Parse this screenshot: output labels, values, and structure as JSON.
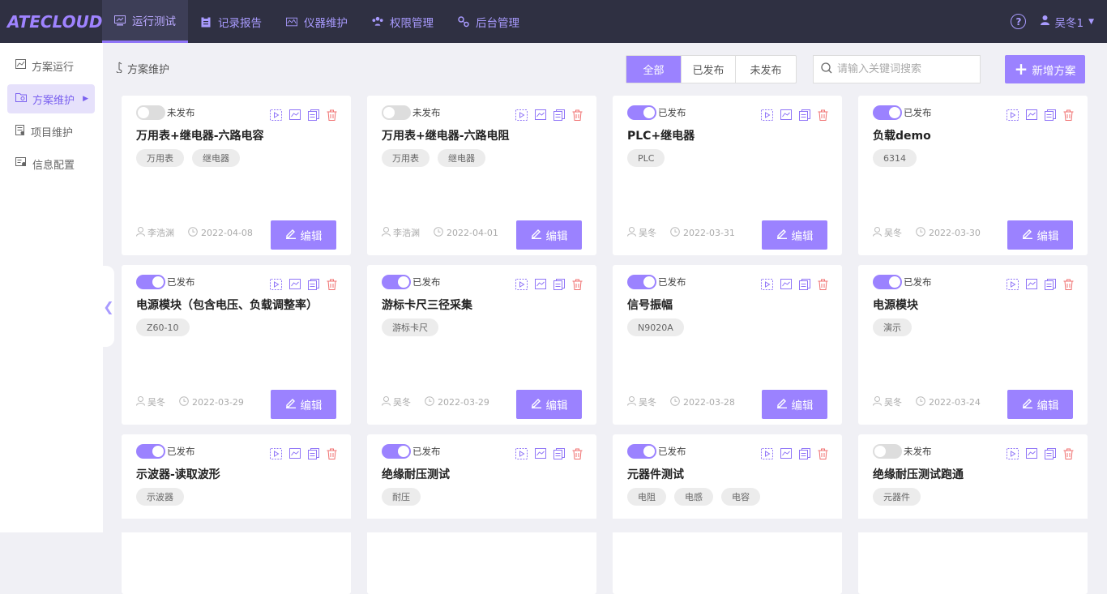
{
  "app": {
    "logo": "ATECLOUD"
  },
  "topnav": [
    {
      "label": "运行测试",
      "icon": "monitor-icon",
      "active": true
    },
    {
      "label": "记录报告",
      "icon": "clipboard-icon",
      "active": false
    },
    {
      "label": "仪器维护",
      "icon": "instrument-icon",
      "active": false
    },
    {
      "label": "权限管理",
      "icon": "users-icon",
      "active": false
    },
    {
      "label": "后台管理",
      "icon": "settings-nodes-icon",
      "active": false
    }
  ],
  "user": {
    "name": "吴冬1",
    "help": "?"
  },
  "sidebar": [
    {
      "label": "方案运行",
      "icon": "chart-icon",
      "active": false
    },
    {
      "label": "方案维护",
      "icon": "folder-icon",
      "active": true
    },
    {
      "label": "项目维护",
      "icon": "document-icon",
      "active": false
    },
    {
      "label": "信息配置",
      "icon": "config-icon",
      "active": false
    }
  ],
  "breadcrumb": "方案维护",
  "filters": [
    "全部",
    "已发布",
    "未发布"
  ],
  "search": {
    "placeholder": "请输入关键词搜索"
  },
  "add_button": "新增方案",
  "edit_label": "编辑",
  "cards": [
    {
      "published": false,
      "status": "未发布",
      "title": "万用表+继电器-六路电容",
      "tags": [
        "万用表",
        "继电器"
      ],
      "author": "李浩渊",
      "date": "2022-04-08"
    },
    {
      "published": false,
      "status": "未发布",
      "title": "万用表+继电器-六路电阻",
      "tags": [
        "万用表",
        "继电器"
      ],
      "author": "李浩渊",
      "date": "2022-04-01"
    },
    {
      "published": true,
      "status": "已发布",
      "title": "PLC+继电器",
      "tags": [
        "PLC"
      ],
      "author": "吴冬",
      "date": "2022-03-31"
    },
    {
      "published": true,
      "status": "已发布",
      "title": "负载demo",
      "tags": [
        "6314"
      ],
      "author": "吴冬",
      "date": "2022-03-30"
    },
    {
      "published": true,
      "status": "已发布",
      "title": "电源模块（包含电压、负载调整率）",
      "tags": [
        "Z60-10"
      ],
      "author": "吴冬",
      "date": "2022-03-29"
    },
    {
      "published": true,
      "status": "已发布",
      "title": "游标卡尺三径采集",
      "tags": [
        "游标卡尺"
      ],
      "author": "吴冬",
      "date": "2022-03-29"
    },
    {
      "published": true,
      "status": "已发布",
      "title": "信号振幅",
      "tags": [
        "N9020A"
      ],
      "author": "吴冬",
      "date": "2022-03-28"
    },
    {
      "published": true,
      "status": "已发布",
      "title": "电源模块",
      "tags": [
        "演示"
      ],
      "author": "吴冬",
      "date": "2022-03-24"
    },
    {
      "published": true,
      "status": "已发布",
      "title": "示波器-读取波形",
      "tags": [
        "示波器"
      ],
      "author": "",
      "date": ""
    },
    {
      "published": true,
      "status": "已发布",
      "title": "绝缘耐压测试",
      "tags": [
        "耐压"
      ],
      "author": "",
      "date": ""
    },
    {
      "published": true,
      "status": "已发布",
      "title": "元器件测试",
      "tags": [
        "电阻",
        "电感",
        "电容"
      ],
      "author": "",
      "date": ""
    },
    {
      "published": false,
      "status": "未发布",
      "title": "绝缘耐压测试跑通",
      "tags": [
        "元器件"
      ],
      "author": "",
      "date": ""
    }
  ],
  "colors": {
    "accent": "#9b82ff",
    "topbar": "#2f3042",
    "delete": "#f07070"
  }
}
